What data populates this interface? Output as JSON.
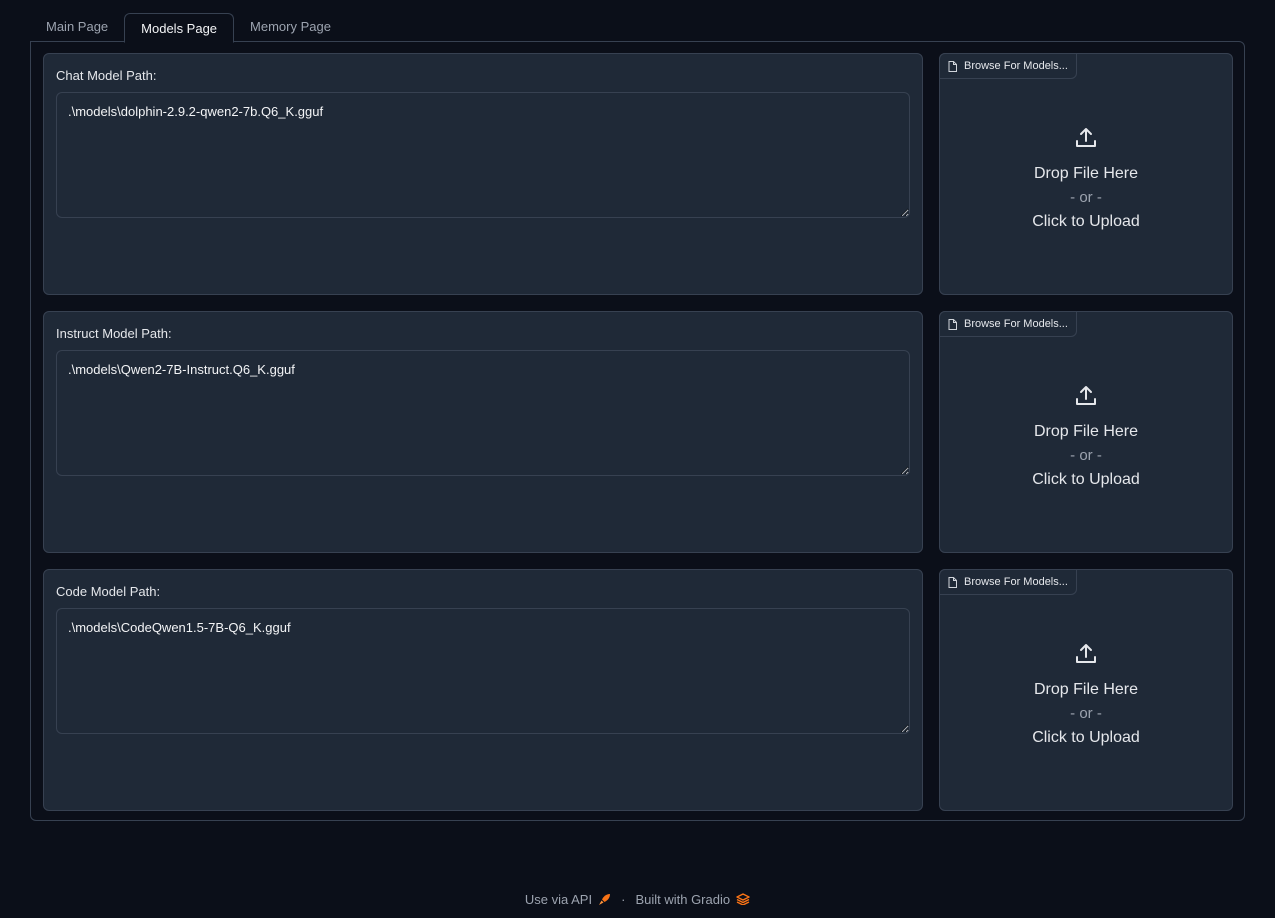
{
  "tabs": [
    {
      "label": "Main Page"
    },
    {
      "label": "Models Page"
    },
    {
      "label": "Memory Page"
    }
  ],
  "rows": [
    {
      "label": "Chat Model Path:",
      "value": ".\\models\\dolphin-2.9.2-qwen2-7b.Q6_K.gguf",
      "upload_label": "Browse For Models..."
    },
    {
      "label": "Instruct Model Path:",
      "value": ".\\models\\Qwen2-7B-Instruct.Q6_K.gguf",
      "upload_label": "Browse For Models..."
    },
    {
      "label": "Code Model Path:",
      "value": ".\\models\\CodeQwen1.5-7B-Q6_K.gguf",
      "upload_label": "Browse For Models..."
    }
  ],
  "upload": {
    "drop": "Drop File Here",
    "or": "- or -",
    "click": "Click to Upload"
  },
  "footer": {
    "api": "Use via API",
    "separator": "·",
    "built": "Built with Gradio"
  },
  "colors": {
    "background": "#0b0f19",
    "panel": "#1f2937",
    "border": "#374151",
    "accent": "#f97316"
  }
}
